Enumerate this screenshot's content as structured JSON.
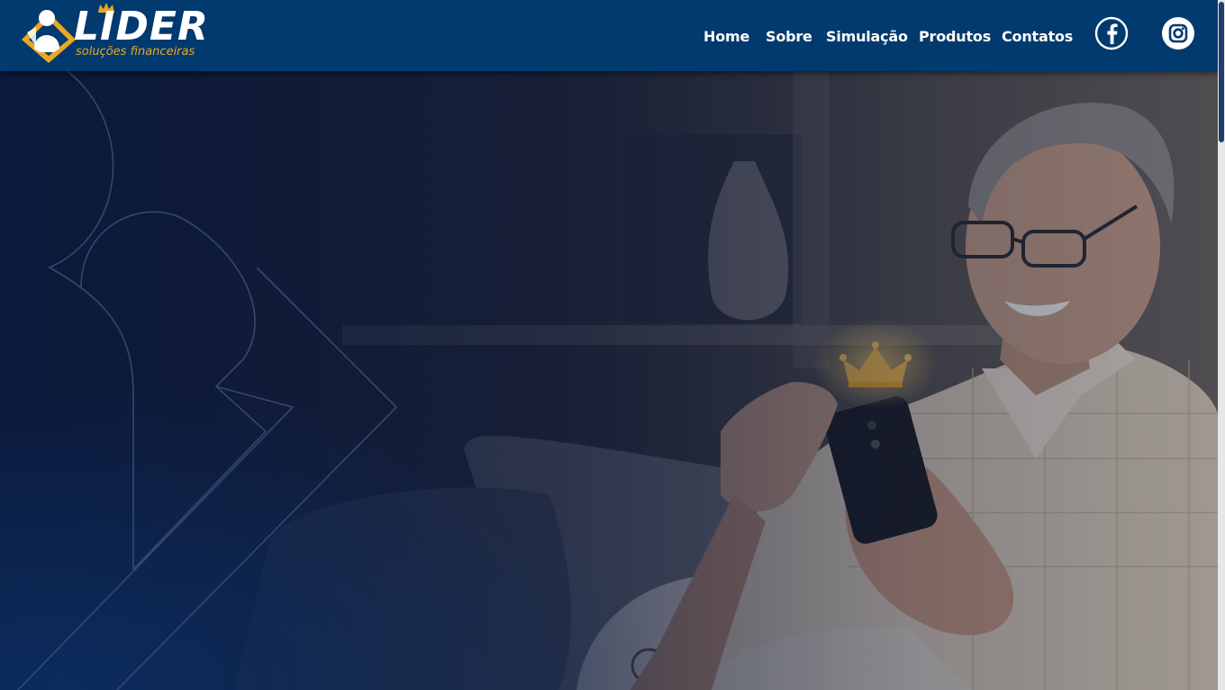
{
  "brand": {
    "name": "LIDER",
    "tagline": "soluções financeiras",
    "colors": {
      "header": "#003a6e",
      "accent": "#e9a722",
      "text": "#ffffff"
    }
  },
  "nav": {
    "items": [
      {
        "label": "Home"
      },
      {
        "label": "Sobre"
      },
      {
        "label": "Simulação"
      },
      {
        "label": "Produtos"
      },
      {
        "label": "Contatos"
      }
    ]
  },
  "social": {
    "facebook": {
      "icon": "facebook-icon",
      "label": "f"
    },
    "instagram": {
      "icon": "instagram-icon"
    }
  },
  "hero": {
    "image": "senior man smiling while using a smartphone on a sofa, glowing crown above the phone",
    "overlay_color": "#0d1a38"
  }
}
